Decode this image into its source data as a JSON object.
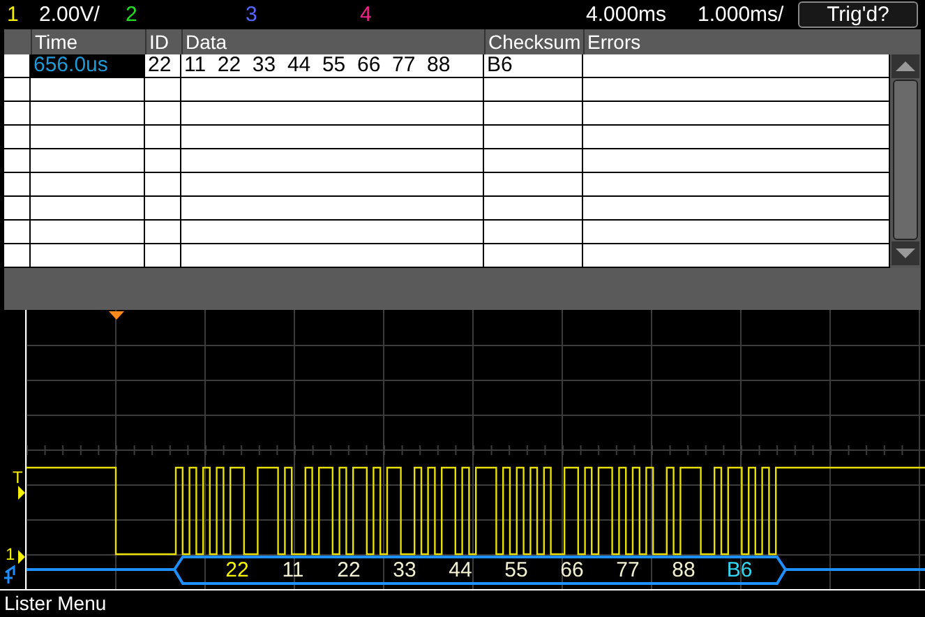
{
  "channels": [
    {
      "label": "1",
      "scale": "2.00V/",
      "color": "#f5f000"
    },
    {
      "label": "2",
      "color": "#22dd22"
    },
    {
      "label": "3",
      "color": "#5566ff"
    },
    {
      "label": "4",
      "color": "#ee2288"
    }
  ],
  "timebase": {
    "delay": "4.000ms",
    "scale": "1.000ms/"
  },
  "trigger_button": "Trig'd?",
  "table": {
    "columns": [
      "Time",
      "ID",
      "Data",
      "Checksum",
      "Errors"
    ],
    "rows": [
      {
        "selected": true,
        "cells": [
          "656.0us",
          "22",
          "11  22  33  44  55  66  77  88",
          "B6",
          ""
        ]
      }
    ]
  },
  "markers": {
    "trigger_level": "T",
    "channel": "1"
  },
  "decode": [
    {
      "kind": "id",
      "text": "22"
    },
    {
      "kind": "data",
      "text": "11"
    },
    {
      "kind": "data",
      "text": "22"
    },
    {
      "kind": "data",
      "text": "33"
    },
    {
      "kind": "data",
      "text": "44"
    },
    {
      "kind": "data",
      "text": "55"
    },
    {
      "kind": "data",
      "text": "66"
    },
    {
      "kind": "data",
      "text": "77"
    },
    {
      "kind": "data",
      "text": "88"
    },
    {
      "kind": "checksum",
      "text": "B6"
    }
  ],
  "softkey_title": "Lister Menu"
}
